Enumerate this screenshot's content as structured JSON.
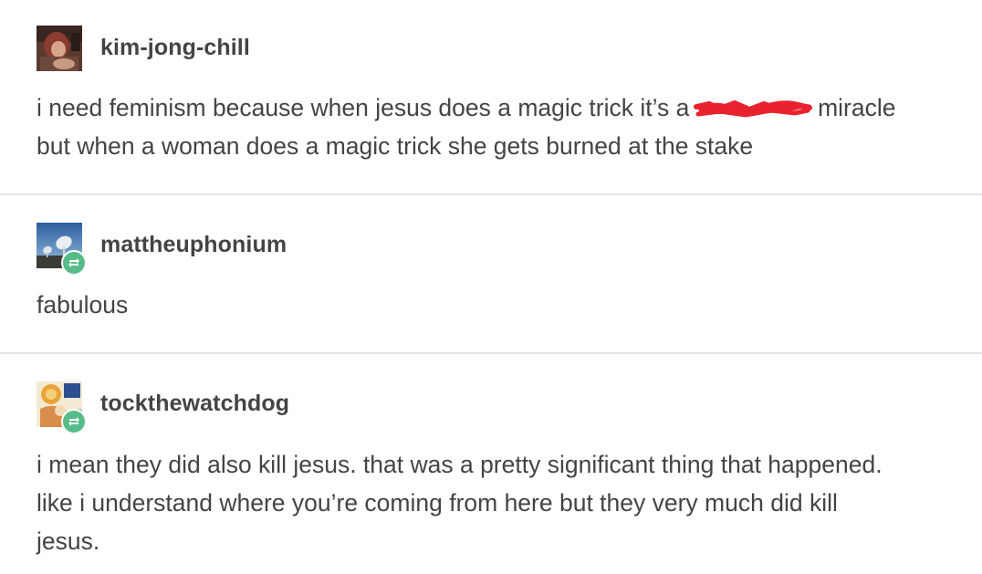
{
  "posts": [
    {
      "username": "kim-jong-chill",
      "line1_before": "i need feminism because when jesus does a magic trick it’s a ",
      "line1_after": " miracle",
      "line2": "but when a woman does a magic trick she gets burned at the stake",
      "redaction_color": "#e8232e",
      "reblog": false
    },
    {
      "username": "mattheuphonium",
      "lines": [
        "fabulous"
      ],
      "reblog": true
    },
    {
      "username": "tockthewatchdog",
      "lines": [
        "i mean they did also kill jesus. that was a pretty significant thing that happened.",
        "like i understand where you’re coming from here but they very much did kill",
        "jesus."
      ],
      "reblog": true
    }
  ],
  "colors": {
    "text": "#444444",
    "divider": "#e3e3e3",
    "reblog_badge": "#56bc8a",
    "redaction": "#e8232e"
  },
  "icons": {
    "reblog_badge": "reblog-icon"
  }
}
